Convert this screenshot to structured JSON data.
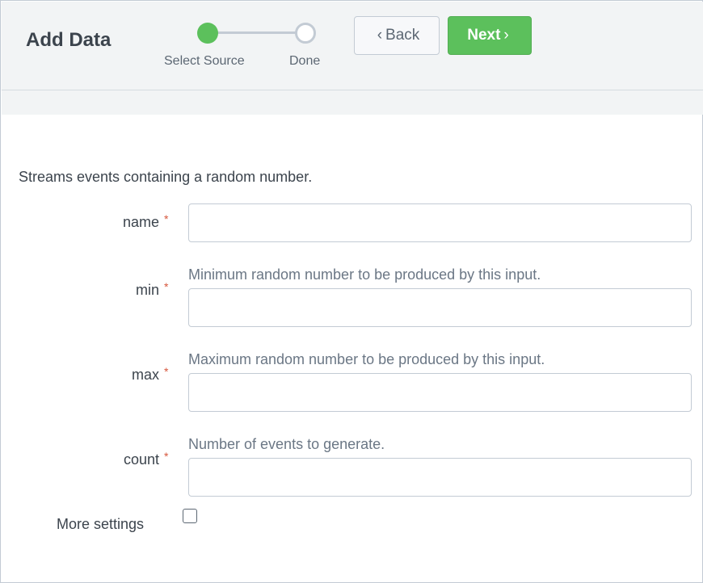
{
  "header": {
    "title": "Add Data",
    "steps": [
      {
        "label": "Select Source",
        "state": "active"
      },
      {
        "label": "Done",
        "state": "inactive"
      }
    ],
    "back_label": "Back",
    "next_label": "Next",
    "back_icon": "chevron-left-icon",
    "next_icon": "chevron-right-icon"
  },
  "form": {
    "description": "Streams events containing a random number.",
    "required_marker": "*",
    "fields": [
      {
        "label": "name",
        "help": "",
        "value": ""
      },
      {
        "label": "min",
        "help": "Minimum random number to be produced by this input.",
        "value": ""
      },
      {
        "label": "max",
        "help": "Maximum random number to be produced by this input.",
        "value": ""
      },
      {
        "label": "count",
        "help": "Number of events to generate.",
        "value": ""
      }
    ],
    "more_settings_label": "More settings",
    "more_settings_checked": false
  },
  "colors": {
    "accent_green": "#5cc05c",
    "header_bg": "#f2f4f5",
    "required_red": "#d6563c"
  }
}
